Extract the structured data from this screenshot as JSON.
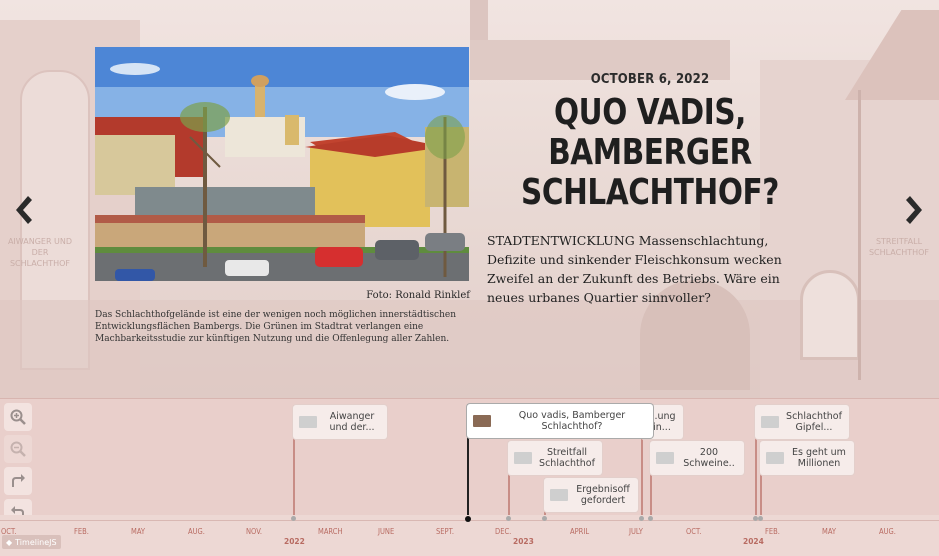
{
  "slide": {
    "date": "OCTOBER 6, 2022",
    "headline": "QUO VADIS, BAMBERGER SCHLACHTHOF?",
    "teaser": "STADTENTWICKLUNG Massenschlachtung, Defizite und sinkender Fleischkonsum wecken Zweifel an der Zukunft des Betriebs. Wäre ein neues urbanes Quartier sinnvoller?",
    "credit": "Foto: Ronald Rinklef",
    "caption": "Das Schlachthofgelände ist eine der wenigen noch möglichen innerstädtischen Entwicklungsflächen Bambergs. Die Grünen im Stadtrat verlangen eine Machbarkeitsstudie zur künftigen Nutzung und die Offenlegung aller Zahlen.",
    "prev_label": "AIWANGER UND DER SCHLACHTHOF",
    "next_label": "STREITFALL SCHLACHTHOF"
  },
  "timeline": {
    "markers": [
      {
        "label": "Aiwanger und der..."
      },
      {
        "label": "Quo vadis, Bamberger Schlachthof?"
      },
      {
        "label": "...ung in..."
      },
      {
        "label": "Streitfall Schlachthof"
      },
      {
        "label": "200 Schweine.."
      },
      {
        "label": "Ergebnisoff gefordert"
      },
      {
        "label": "Schlachthof Gipfel..."
      },
      {
        "label": "Es geht um Millionen"
      }
    ],
    "ticks": [
      "OCT.",
      "FEB.",
      "MAY",
      "AUG.",
      "NOV.",
      "MARCH",
      "JUNE",
      "SEPT.",
      "DEC.",
      "APRIL",
      "JULY",
      "OCT.",
      "FEB.",
      "MAY",
      "AUG."
    ],
    "years": [
      "2022",
      "2023",
      "2024"
    ],
    "brand": "TimelineJS"
  },
  "icons": {
    "zoom_in": "zoom-in-icon",
    "zoom_out": "zoom-out-icon",
    "forward": "forward-icon",
    "back": "back-to-start-icon",
    "prev": "chevron-left-icon",
    "next": "chevron-right-icon"
  },
  "colors": {
    "accent": "#c88d86",
    "timeline_bg": "#e9cfcb",
    "tick_text": "#b86b62"
  }
}
